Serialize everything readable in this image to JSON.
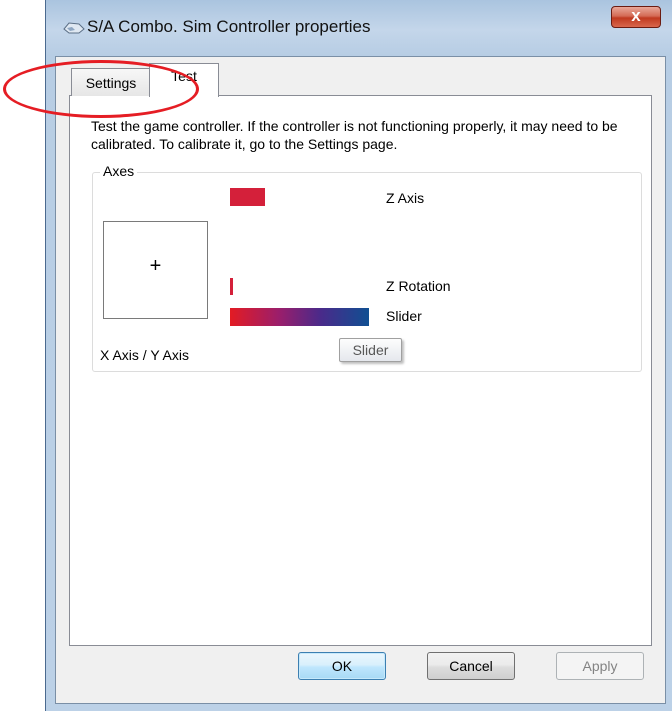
{
  "window": {
    "title": "S/A Combo. Sim Controller properties",
    "close_label": "x",
    "accent_color": "#c0391f"
  },
  "tabs": [
    {
      "label": "Settings",
      "selected": false
    },
    {
      "label": "Test",
      "selected": true
    }
  ],
  "test_page": {
    "description": "Test the game controller.  If the controller is not functioning properly, it may need to be calibrated.  To calibrate it, go to the Settings page.",
    "axes_group_label": "Axes",
    "xy_label": "X Axis / Y Axis",
    "crosshair": "+",
    "axes": [
      {
        "label": "Z Axis",
        "level": 0.25
      },
      {
        "label": "Z Rotation",
        "level": 0.02
      },
      {
        "label": "Slider",
        "level": 1.0
      }
    ],
    "tooltip": "Slider"
  },
  "buttons": {
    "ok": "OK",
    "cancel": "Cancel",
    "apply": "Apply"
  },
  "icons": {
    "app_icon": "game-controller-icon",
    "close_icon": "close-icon"
  }
}
